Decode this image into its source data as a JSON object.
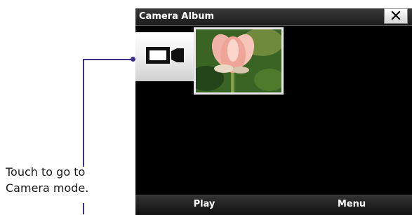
{
  "caption": {
    "line1": "Touch to go to",
    "line2": "Camera mode."
  },
  "window": {
    "title": "Camera Album",
    "close_icon": "close-icon"
  },
  "camera_mode_button": {
    "icon": "video-camera-icon"
  },
  "thumbnail": {
    "subject": "lotus-flower-photo"
  },
  "softkeys": {
    "left": "Play",
    "right": "Menu"
  },
  "colors": {
    "callout": "#3d2f86",
    "screen_background": "#000000",
    "thumbnail_border": "#e8e8e8"
  }
}
